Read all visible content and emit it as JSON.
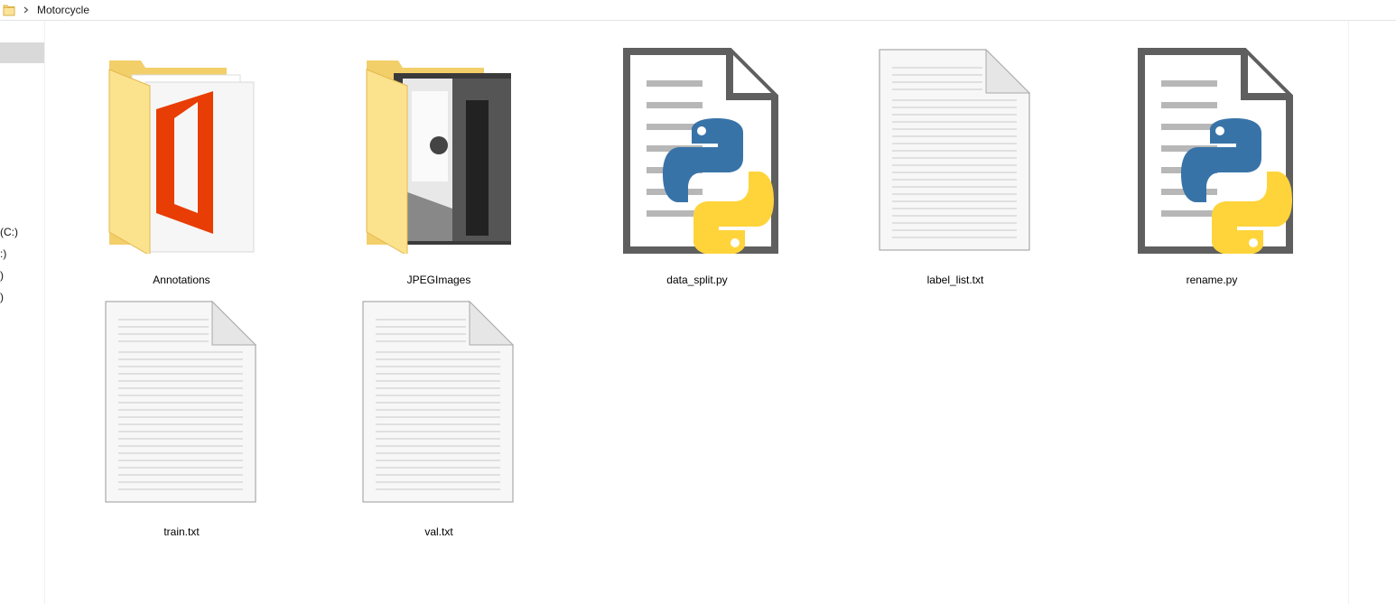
{
  "breadcrumb": {
    "items": [
      "Motorcycle"
    ]
  },
  "nav": {
    "items": [
      {
        "label": " (C:)"
      },
      {
        "label": ":)"
      },
      {
        "label": ")"
      },
      {
        "label": ")"
      }
    ]
  },
  "files": [
    {
      "name": "Annotations",
      "type": "folder-office",
      "icon": "office-folder-icon"
    },
    {
      "name": "JPEGImages",
      "type": "folder-images",
      "icon": "image-folder-icon"
    },
    {
      "name": "data_split.py",
      "type": "python",
      "icon": "python-file-icon"
    },
    {
      "name": "label_list.txt",
      "type": "text",
      "icon": "text-file-icon"
    },
    {
      "name": "rename.py",
      "type": "python",
      "icon": "python-file-icon"
    },
    {
      "name": "train.txt",
      "type": "text",
      "icon": "text-file-icon"
    },
    {
      "name": "val.txt",
      "type": "text",
      "icon": "text-file-icon"
    }
  ],
  "colors": {
    "folder": "#f5d77a",
    "office_red": "#e83d05",
    "python_blue": "#3873a8",
    "python_yellow": "#ffd43b",
    "doc_border": "#5f5f5f"
  }
}
